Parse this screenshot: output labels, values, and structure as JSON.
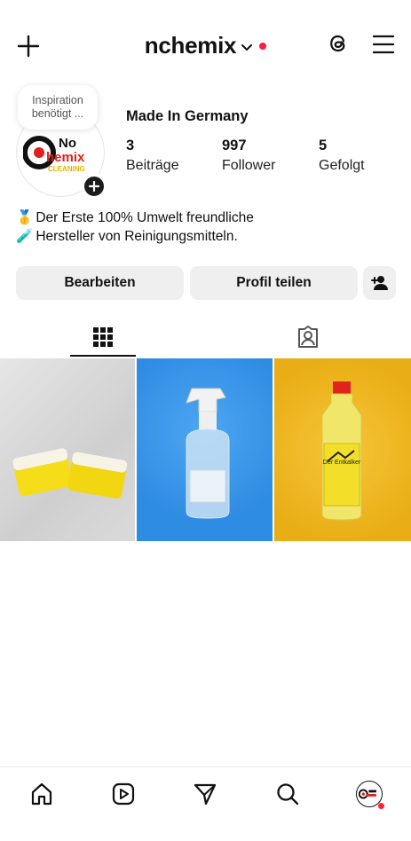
{
  "header": {
    "username": "nchemix"
  },
  "profile": {
    "note_line1": "Inspiration",
    "note_line2": "benötigt ...",
    "logo_text_line1": "No",
    "logo_text_line2": "hemix",
    "logo_text_line3": "CLEANING",
    "display_name": "Made In Germany",
    "stats": [
      {
        "value": "3",
        "label": "Beiträge"
      },
      {
        "value": "997",
        "label": "Follower"
      },
      {
        "value": "5",
        "label": "Gefolgt"
      }
    ],
    "bio": [
      {
        "emoji": "🥇",
        "text": "Der Erste 100% Umwelt freundliche"
      },
      {
        "emoji": "🧪",
        "text": "Hersteller von Reinigungsmitteln."
      }
    ]
  },
  "actions": {
    "edit_label": "Bearbeiten",
    "share_label": "Profil teilen"
  },
  "posts": [
    {
      "subject": "sponge-photo"
    },
    {
      "subject": "spray-bottle-photo"
    },
    {
      "subject": "descaler-bottle-photo",
      "label": "Der Entkalker"
    }
  ],
  "colors": {
    "accent_red": "#ff1f3d",
    "button_bg": "#efefef",
    "post2_bg": "#3a97ea",
    "post3_bg": "#efb826"
  }
}
